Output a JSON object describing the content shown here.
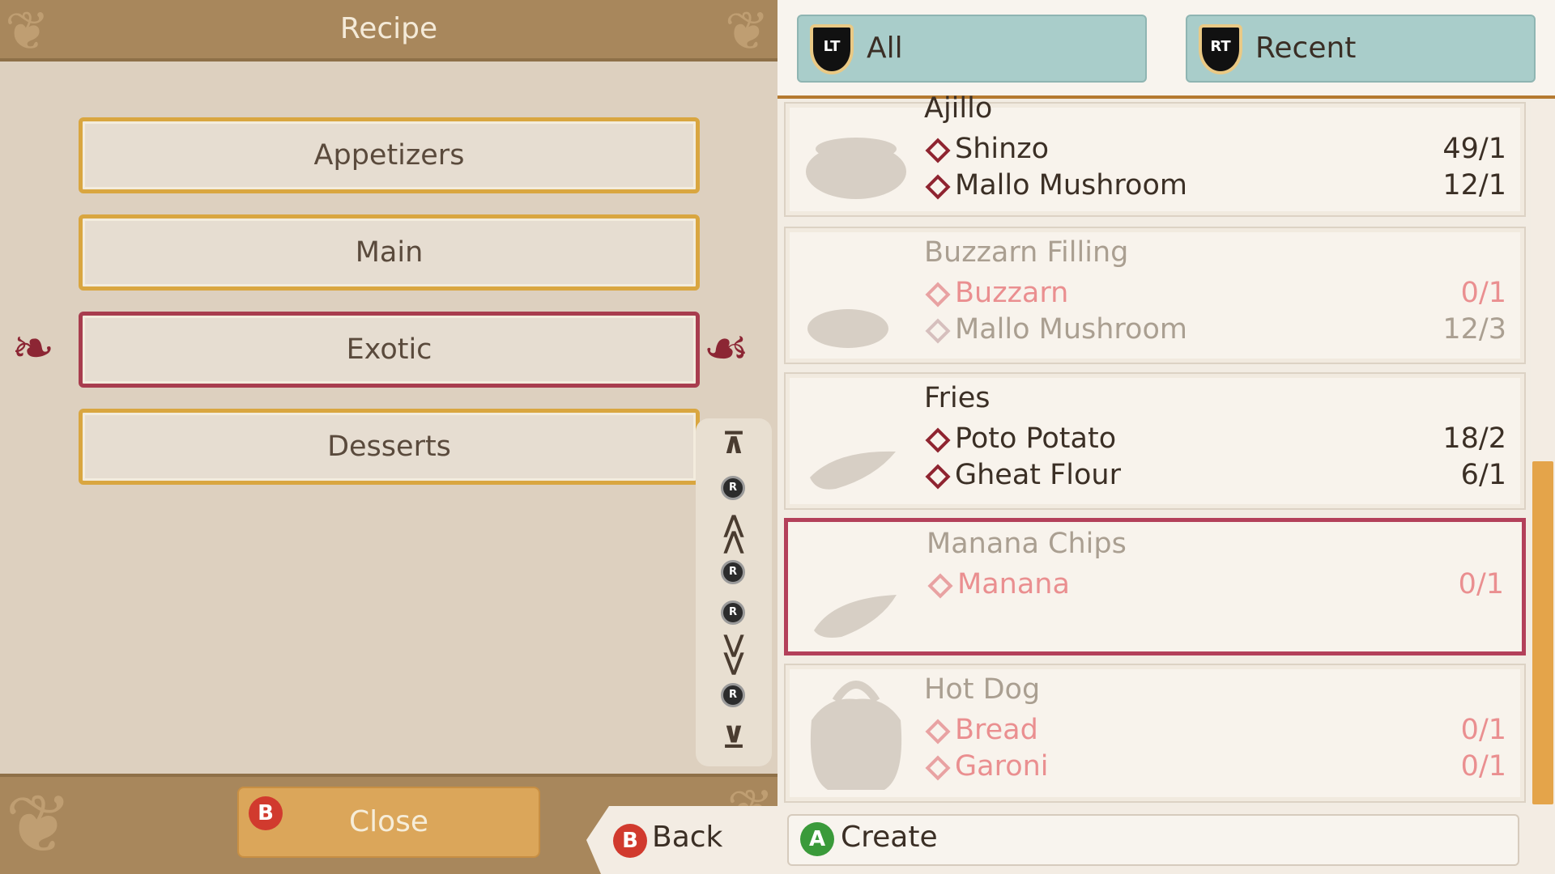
{
  "left": {
    "title": "Recipe",
    "categories": [
      "Appetizers",
      "Main",
      "Exotic",
      "Desserts"
    ],
    "selected_category": "Exotic",
    "close_label": "Close",
    "close_button_key": "B",
    "scroll_stick_label": "R"
  },
  "back": {
    "button_key": "B",
    "label": "Back"
  },
  "tabs": [
    {
      "trigger": "LT",
      "label": "All"
    },
    {
      "trigger": "RT",
      "label": "Recent"
    }
  ],
  "recipes": [
    {
      "name": "Ajillo",
      "available": true,
      "ingredients": [
        {
          "name": "Shinzo",
          "qty": "49/1",
          "state": "ok"
        },
        {
          "name": "Mallo Mushroom",
          "qty": "12/1",
          "state": "ok"
        }
      ]
    },
    {
      "name": "Buzzarn Filling",
      "available": false,
      "ingredients": [
        {
          "name": "Buzzarn",
          "qty": "0/1",
          "state": "missing"
        },
        {
          "name": "Mallo Mushroom",
          "qty": "12/3",
          "state": "dim"
        }
      ]
    },
    {
      "name": "Fries",
      "available": true,
      "ingredients": [
        {
          "name": "Poto Potato",
          "qty": "18/2",
          "state": "ok"
        },
        {
          "name": "Gheat Flour",
          "qty": "6/1",
          "state": "ok"
        }
      ]
    },
    {
      "name": "Manana Chips",
      "available": false,
      "selected": true,
      "ingredients": [
        {
          "name": "Manana",
          "qty": "0/1",
          "state": "missing"
        }
      ]
    },
    {
      "name": "Hot Dog",
      "available": false,
      "ingredients": [
        {
          "name": "Bread",
          "qty": "0/1",
          "state": "missing"
        },
        {
          "name": "Garoni",
          "qty": "0/1",
          "state": "missing"
        }
      ]
    }
  ],
  "create": {
    "button_key": "A",
    "label": "Create"
  },
  "colors": {
    "accent_gold": "#d9a640",
    "selected_red": "#a83d4e",
    "missing_pink": "#ea8f90",
    "tab_teal": "#a9cdca"
  }
}
